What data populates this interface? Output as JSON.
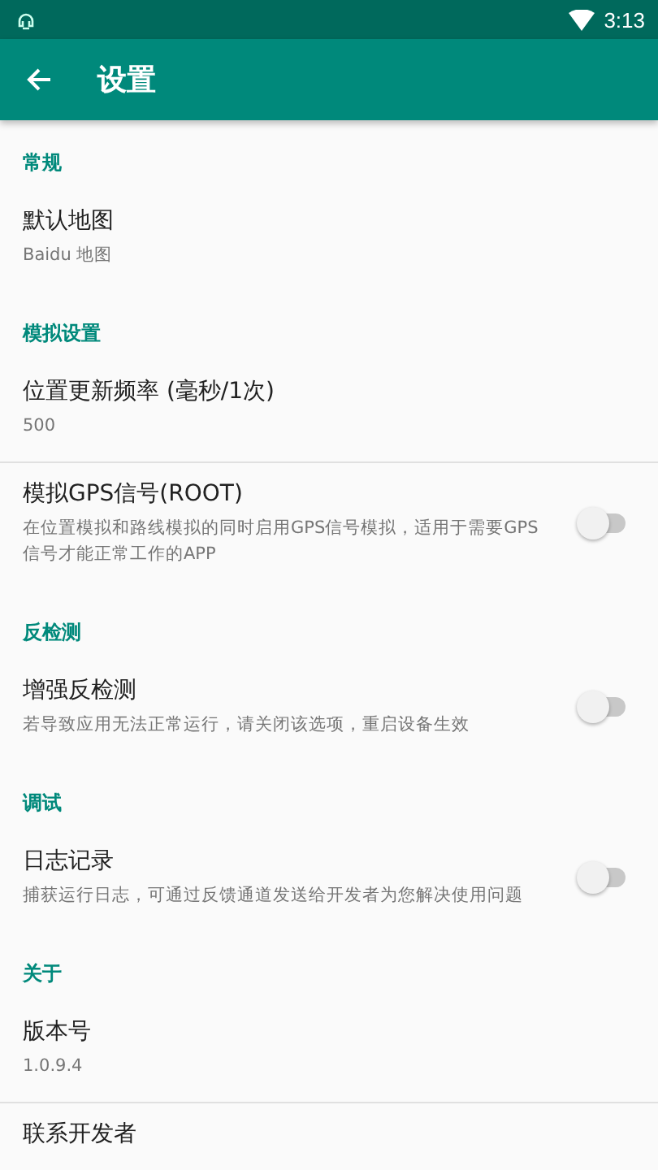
{
  "status_bar": {
    "time": "3:13"
  },
  "toolbar": {
    "title": "设置"
  },
  "sections": [
    {
      "header": "常规",
      "items": [
        {
          "title": "默认地图",
          "summary": "Baidu 地图",
          "kind": "text"
        }
      ]
    },
    {
      "header": "模拟设置",
      "items": [
        {
          "title": "位置更新频率 (毫秒/1次)",
          "summary": "500",
          "kind": "text"
        },
        {
          "title": "模拟GPS信号(ROOT)",
          "summary": "在位置模拟和路线模拟的同时启用GPS信号模拟，适用于需要GPS信号才能正常工作的APP",
          "kind": "switch",
          "on": false
        }
      ]
    },
    {
      "header": "反检测",
      "items": [
        {
          "title": "增强反检测",
          "summary": "若导致应用无法正常运行，请关闭该选项，重启设备生效",
          "kind": "switch",
          "on": false
        }
      ]
    },
    {
      "header": "调试",
      "items": [
        {
          "title": "日志记录",
          "summary": "捕获运行日志，可通过反馈通道发送给开发者为您解决使用问题",
          "kind": "switch",
          "on": false
        }
      ]
    },
    {
      "header": "关于",
      "items": [
        {
          "title": "版本号",
          "summary": "1.0.9.4",
          "kind": "text"
        },
        {
          "title": "联系开发者",
          "kind": "text"
        }
      ]
    }
  ]
}
